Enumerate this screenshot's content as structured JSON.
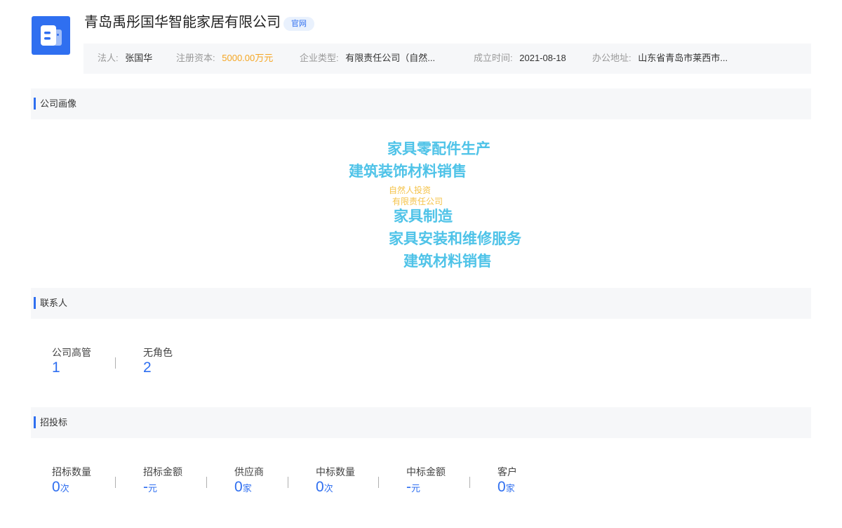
{
  "header": {
    "company_name": "青岛禹彤国华智能家居有限公司",
    "official_badge": "官网",
    "logo_icon": "building-icon",
    "accent_color": "#2f6ff0"
  },
  "info": {
    "legal_rep_label": "法人:",
    "legal_rep_value": "张国华",
    "capital_label": "注册资本:",
    "capital_value": "5000.00万元",
    "type_label": "企业类型:",
    "type_value": "有限责任公司（自然...",
    "founded_label": "成立时间:",
    "founded_value": "2021-08-18",
    "address_label": "办公地址:",
    "address_value": "山东省青岛市莱西市..."
  },
  "profile": {
    "title": "公司画像",
    "words": [
      "家具零配件生产",
      "建筑装饰材料销售",
      "自然人投资",
      "有限责任公司",
      "家具制造",
      "家具安装和维修服务",
      "建筑材料销售"
    ],
    "big_color": "#4fc3e8",
    "small_color": "#f5c34a"
  },
  "contacts": {
    "title": "联系人",
    "stats": [
      {
        "label": "公司高管",
        "value": "1"
      },
      {
        "label": "无角色",
        "value": "2"
      }
    ]
  },
  "bidding": {
    "title": "招投标",
    "stats": [
      {
        "label": "招标数量",
        "value": "0",
        "unit": "次"
      },
      {
        "label": "招标金额",
        "value": "-",
        "unit": "元"
      },
      {
        "label": "供应商",
        "value": "0",
        "unit": "家"
      },
      {
        "label": "中标数量",
        "value": "0",
        "unit": "次"
      },
      {
        "label": "中标金额",
        "value": "-",
        "unit": "元"
      },
      {
        "label": "客户",
        "value": "0",
        "unit": "家"
      }
    ]
  }
}
